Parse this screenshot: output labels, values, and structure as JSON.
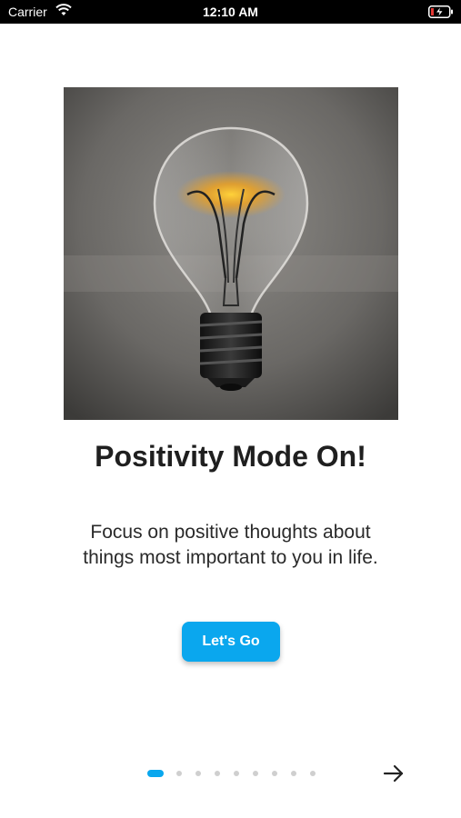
{
  "status_bar": {
    "carrier": "Carrier",
    "time": "12:10 AM"
  },
  "hero": {
    "icon": "lightbulb-image"
  },
  "content": {
    "title": "Positivity Mode On!",
    "description_line1": "Focus on positive thoughts about",
    "description_line2": "things most important to you in life."
  },
  "cta": {
    "label": "Let's Go"
  },
  "pager": {
    "total": 9,
    "current": 1,
    "active_color": "#0aa7ee",
    "inactive_color": "#cfcfcf"
  },
  "nav": {
    "next_icon": "arrow-right-icon"
  }
}
